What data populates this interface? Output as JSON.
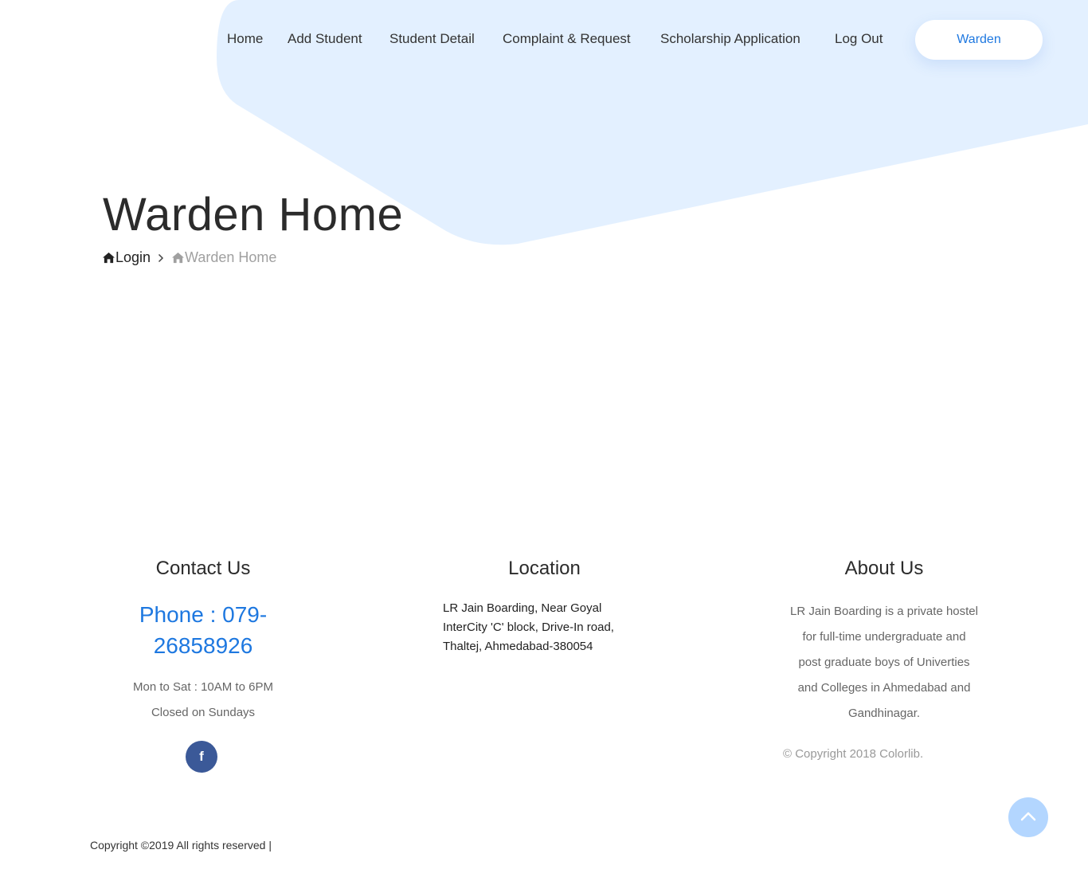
{
  "nav": {
    "items": [
      "Home",
      "Add Student",
      "Student Detail",
      "Complaint & Request",
      "Scholarship Application",
      "Log Out"
    ],
    "role_button": "Warden"
  },
  "page": {
    "title": "Warden Home",
    "breadcrumb": [
      "Login",
      "Warden Home"
    ]
  },
  "footer": {
    "contact": {
      "heading": "Contact Us",
      "phone_line1": "Phone : 079-",
      "phone_line2": "26858926",
      "hours_line1": "Mon to Sat : 10AM to 6PM",
      "hours_line2": "Closed on Sundays",
      "social_icon": "facebook-icon"
    },
    "location": {
      "heading": "Location",
      "address_line1": "LR Jain Boarding, Near Goyal",
      "address_line2": "InterCity 'C' block, Drive-In road,",
      "address_line3": "Thaltej, Ahmedabad-380054"
    },
    "about": {
      "heading": "About Us",
      "text_line1": "LR Jain Boarding is a private hostel",
      "text_line2": "for full-time undergraduate and",
      "text_line3": "post graduate boys of Univerties",
      "text_line4": "and Colleges in Ahmedabad and",
      "text_line5": "Gandhinagar.",
      "copyright": "© Copyright 2018 Colorlib."
    },
    "bottom_copyright": "Copyright ©2019 All rights reserved |"
  },
  "colors": {
    "accent": "#1e78e0",
    "shape": "#e3f0ff",
    "facebook": "#3b5998",
    "scroll_top": "#b3d6ff"
  }
}
